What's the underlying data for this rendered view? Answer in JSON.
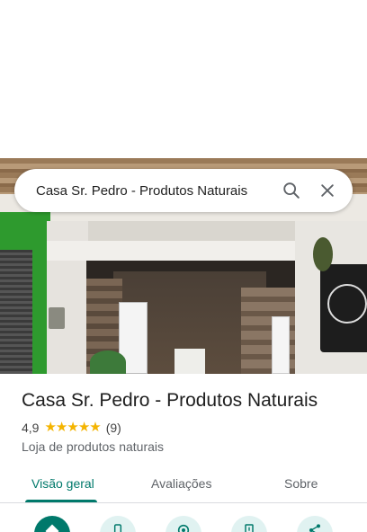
{
  "search": {
    "query": "Casa Sr. Pedro - Produtos Naturais",
    "search_icon": "search-icon",
    "close_icon": "close-icon"
  },
  "place": {
    "name": "Casa Sr. Pedro - Produtos Naturais",
    "rating": "4,9",
    "stars": 5,
    "review_count": "(9)",
    "category": "Loja de produtos naturais"
  },
  "tabs": [
    {
      "label": "Visão geral",
      "active": true
    },
    {
      "label": "Avaliações",
      "active": false
    },
    {
      "label": "Sobre",
      "active": false
    }
  ],
  "actions": [
    {
      "icon": "directions-icon"
    },
    {
      "icon": "phone-icon"
    },
    {
      "icon": "location-icon"
    },
    {
      "icon": "save-icon"
    },
    {
      "icon": "share-icon"
    }
  ],
  "colors": {
    "accent": "#00796b",
    "star": "#f4b400",
    "text_primary": "#1f1f1f",
    "text_secondary": "#5f6368"
  }
}
